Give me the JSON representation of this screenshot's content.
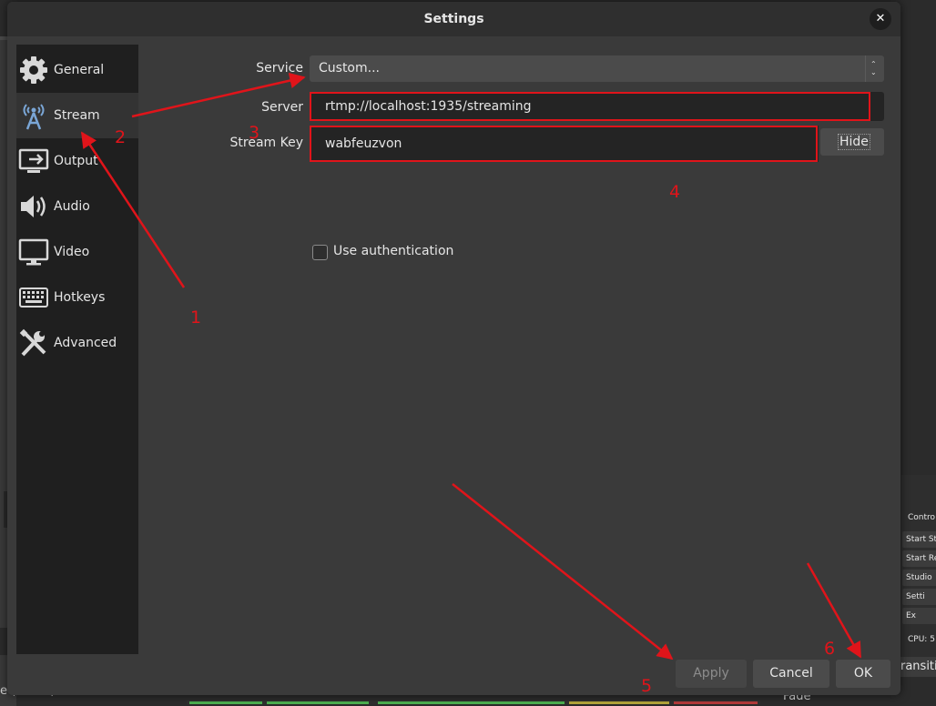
{
  "dialog": {
    "title": "Settings",
    "close_icon": "close-icon"
  },
  "sidebar": {
    "items": [
      {
        "label": "General",
        "icon": "gear-icon"
      },
      {
        "label": "Stream",
        "icon": "antenna-icon",
        "active": true
      },
      {
        "label": "Output",
        "icon": "output-monitor-icon"
      },
      {
        "label": "Audio",
        "icon": "speaker-icon"
      },
      {
        "label": "Video",
        "icon": "monitor-icon"
      },
      {
        "label": "Hotkeys",
        "icon": "keyboard-icon"
      },
      {
        "label": "Advanced",
        "icon": "tools-icon"
      }
    ]
  },
  "stream": {
    "service_label": "Service",
    "service_value": "Custom...",
    "server_label": "Server",
    "server_value": "rtmp://localhost:1935/streaming",
    "stream_key_label": "Stream Key",
    "stream_key_value": "wabfeuzvon",
    "hide_button": "Hide",
    "use_auth_label": "Use authentication",
    "use_auth_checked": false
  },
  "buttons": {
    "apply": "Apply",
    "cancel": "Cancel",
    "ok": "OK"
  },
  "annotations": {
    "color": "#e0141a",
    "numbers": [
      "1",
      "2",
      "3",
      "4",
      "5",
      "6"
    ]
  },
  "background_window": {
    "controls": [
      "Contro",
      "Start Stre",
      "Start Rec",
      "Studio",
      "Setti",
      "Ex"
    ],
    "cpu": "CPU: 5",
    "transition": "ransiti",
    "fade": "Fade",
    "audio_source": "e (XSHM)"
  }
}
